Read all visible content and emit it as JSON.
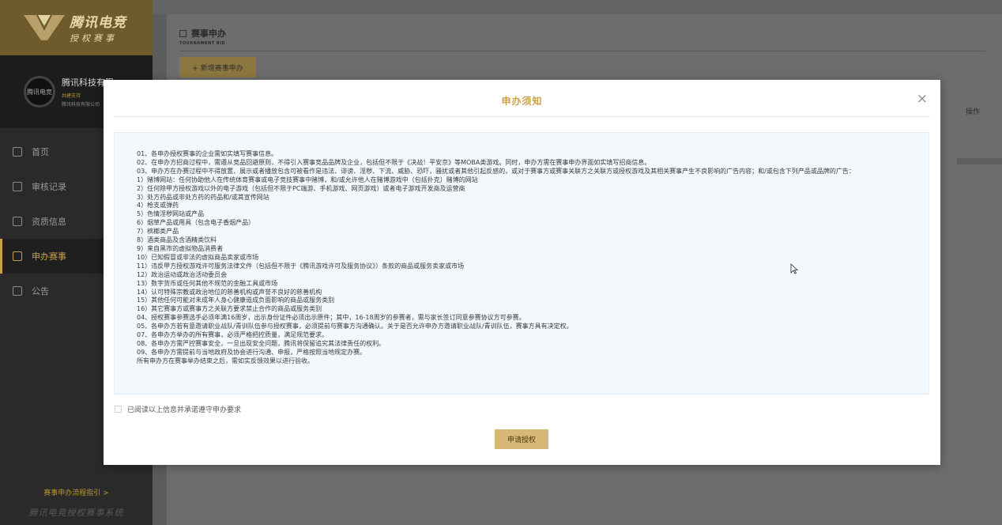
{
  "brand": {
    "logo_line1": "腾讯电竞",
    "logo_line2": "授权赛事",
    "system_name": "腾讯电竞授权赛事系统"
  },
  "org": {
    "avatar_text": "腾讯电竞",
    "name": "腾讯科技有限",
    "tag": "共建支持",
    "sub": "腾讯科技有限公司"
  },
  "nav": {
    "items": [
      {
        "label": "首页",
        "icon": "home-icon"
      },
      {
        "label": "审核记录",
        "icon": "audit-icon"
      },
      {
        "label": "资质信息",
        "icon": "id-card-icon"
      },
      {
        "label": "申办赛事",
        "icon": "document-icon",
        "active": true
      },
      {
        "label": "公告",
        "icon": "announcement-icon"
      }
    ],
    "guide_link": "赛事申办流程指引 >"
  },
  "page": {
    "title": "赛事申办",
    "subtitle": "TOURNAMENT BID",
    "add_button": "+ 新增赛事申办",
    "column_operation": "操作"
  },
  "modal": {
    "title": "申办须知",
    "close_glyph": "×",
    "lines": [
      "01、各申办授权赛事的企业需如实填写赛事信息。",
      "02、在申办方招商过程中，需遵从竞品回避原则，不得引入赛事竞品品牌及企业，包括但不限于《决战！平安京》等MOBA类游戏。同时，申办方需在赛事申办界面如实填写招商信息。",
      "03、申办方在办赛过程中不得放置、展示或者播放包含可被看作是违法、诽谤、淫秽、下流、威胁、恐吓，骚扰或者其他引起反感的，或对于赛事方或赛事关联方之关联方或授权游戏及其相关赛事产生不良影响的广告内容；和/或包含下列产品或品牌的广告：",
      "1）赌博网站：任何协助他人在传统体育赛事或电子竞技赛事中赌博，和/或允许他人在赌博游戏中（包括扑克）赌博的网站",
      "2）任何除甲方授权游戏以外的电子游戏（包括但不限于PC端游、手机游戏、网页游戏）或者电子游戏开发商及运营商",
      "3）处方药品或非处方药的药品和/或其宣传网站",
      "4）枪支或弹药",
      "5）色情淫秽网站或产品",
      "6）烟草产品或用具（包含电子香烟产品）",
      "7）槟榔类产品",
      "8）酒类商品及含酒精类饮料",
      "9）来自黑市的虚拟物品消费者",
      "10）已知假冒或非法的虚拟商品卖家或市场",
      "11）违反甲方授权游戏许可服务法律文件（包括但不限于《腾讯游戏许可及服务协议》）条款的商品或服务卖家或市场",
      "12）政治运动或政治活动委员会",
      "13）数字货币或任何其他不规范的金融工具或市场",
      "14）认可特殊宗教或政治地位的慈善机构或声誉不良好的慈善机构",
      "15）其他任何可能对未成年人身心健康造成负面影响的商品或服务类别",
      "16）其它赛事方或赛事方之关联方要求禁止合作的商品或服务类别",
      "04、授权赛事参赛选手必须年满16周岁，出示身份证件必须出示原件；其中，16-18周岁的参赛者，需与家长签订同意参赛协议方可参赛。",
      "05、各申办方若有意邀请职业战队/青训队伍参与授权赛事，必须提前与赛事方沟通确认。关于是否允许申办方邀请职业战队/青训队伍，赛事方具有决定权。",
      "07、各申办方举办的所有赛事，必须严格把控质量，满足规范要求。",
      "08、各申办方需严控赛事安全，一旦出现安全问题，腾讯将保留追究其法律责任的权利。",
      "09、各申办方需提前与当地政府及协会进行沟通、申报，严格按照当地规定办赛。",
      "所有申办方在赛事举办结束之后，需如实反馈效果以进行验收。"
    ],
    "agree_label": "已阅读以上信息并承诺遵守申办要求",
    "apply_button": "申请授权"
  }
}
